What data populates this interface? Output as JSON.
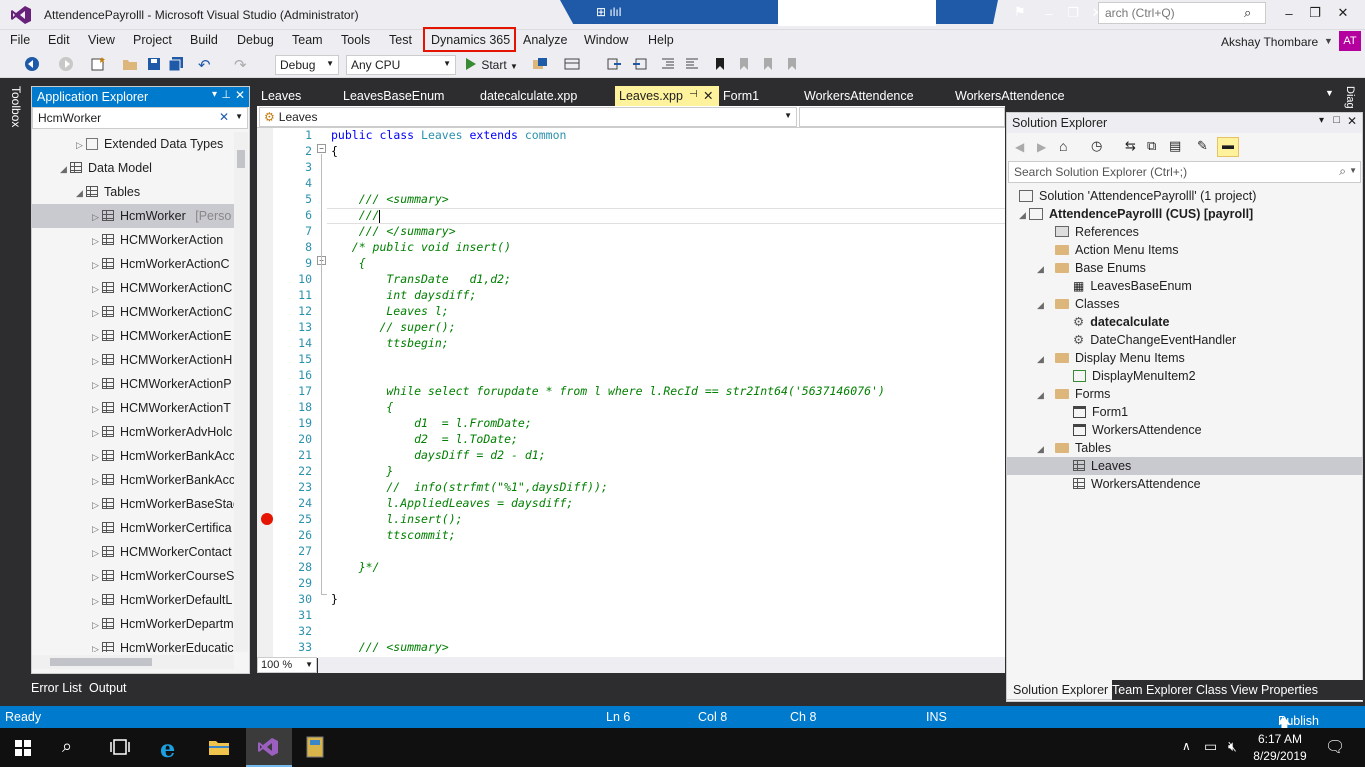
{
  "window": {
    "title": "AttendencePayrolll - Microsoft Visual Studio (Administrator)",
    "quick_launch": "arch (Ctrl+Q)"
  },
  "menu": [
    "File",
    "Edit",
    "View",
    "Project",
    "Build",
    "Debug",
    "Team",
    "Tools",
    "Test",
    "Dynamics 365",
    "Analyze",
    "Window",
    "Help"
  ],
  "user": {
    "name": "Akshay Thombare",
    "initials": "AT"
  },
  "toolbar": {
    "config": "Debug",
    "platform": "Any CPU",
    "start": "Start"
  },
  "toolbox_label": "Toolbox",
  "app_explorer": {
    "title": "Application Explorer",
    "search": "HcmWorker",
    "items": [
      "Extended Data Types",
      "Data Model",
      "Tables",
      "HcmWorker",
      "HCMWorkerAction",
      "HcmWorkerActionC",
      "HCMWorkerActionC",
      "HCMWorkerActionC",
      "HCMWorkerActionE",
      "HCMWorkerActionH",
      "HCMWorkerActionP",
      "HCMWorkerActionT",
      "HcmWorkerAdvHolc",
      "HcmWorkerBankAcc",
      "HcmWorkerBankAcc",
      "HcmWorkerBaseStag",
      "HcmWorkerCertifica",
      "HCMWorkerContact",
      "HcmWorkerCourseS",
      "HcmWorkerDefaultL",
      "HcmWorkerDepartm",
      "HcmWorkerEducatic"
    ],
    "selected_suffix": "[Perso"
  },
  "editor": {
    "tabs": [
      "Leaves",
      "LeavesBaseEnum",
      "datecalculate.xpp",
      "Leaves.xpp",
      "Form1",
      "WorkersAttendence",
      "WorkersAttendence"
    ],
    "active_tab": "Leaves.xpp",
    "nav": "Leaves",
    "zoom": "100 %",
    "lines": [
      {
        "n": "1",
        "t": "public class Leaves extends common",
        "k": "decl"
      },
      {
        "n": "2",
        "t": "{",
        "k": "plain"
      },
      {
        "n": "3",
        "t": "",
        "k": "plain"
      },
      {
        "n": "4",
        "t": "",
        "k": "plain"
      },
      {
        "n": "5",
        "t": "    /// <summary>",
        "k": "cm"
      },
      {
        "n": "6",
        "t": "    ///",
        "k": "cm"
      },
      {
        "n": "7",
        "t": "    /// </summary>",
        "k": "cm"
      },
      {
        "n": "8",
        "t": "   /* public void insert()",
        "k": "cm"
      },
      {
        "n": "9",
        "t": "    {",
        "k": "cm"
      },
      {
        "n": "10",
        "t": "        TransDate   d1,d2;",
        "k": "cm"
      },
      {
        "n": "11",
        "t": "        int daysdiff;",
        "k": "cm"
      },
      {
        "n": "12",
        "t": "        Leaves l;",
        "k": "cm"
      },
      {
        "n": "13",
        "t": "       // super();",
        "k": "cm"
      },
      {
        "n": "14",
        "t": "        ttsbegin;",
        "k": "cm"
      },
      {
        "n": "15",
        "t": "",
        "k": "cm"
      },
      {
        "n": "16",
        "t": "",
        "k": "cm"
      },
      {
        "n": "17",
        "t": "        while select forupdate * from l where l.RecId == str2Int64('5637146076')",
        "k": "cm"
      },
      {
        "n": "18",
        "t": "        {",
        "k": "cm"
      },
      {
        "n": "19",
        "t": "            d1  = l.FromDate;",
        "k": "cm"
      },
      {
        "n": "20",
        "t": "            d2  = l.ToDate;",
        "k": "cm"
      },
      {
        "n": "21",
        "t": "            daysDiff = d2 - d1;",
        "k": "cm"
      },
      {
        "n": "22",
        "t": "        }",
        "k": "cm"
      },
      {
        "n": "23",
        "t": "        //  info(strfmt(\"%1\",daysDiff));",
        "k": "cm"
      },
      {
        "n": "24",
        "t": "        l.AppliedLeaves = daysdiff;",
        "k": "cm"
      },
      {
        "n": "25",
        "t": "        l.insert();",
        "k": "cm"
      },
      {
        "n": "26",
        "t": "        ttscommit;",
        "k": "cm"
      },
      {
        "n": "27",
        "t": "",
        "k": "cm"
      },
      {
        "n": "28",
        "t": "    }*/",
        "k": "cm"
      },
      {
        "n": "29",
        "t": "",
        "k": "plain"
      },
      {
        "n": "30",
        "t": "}",
        "k": "plain"
      },
      {
        "n": "31",
        "t": "",
        "k": "plain"
      },
      {
        "n": "32",
        "t": "",
        "k": "plain"
      },
      {
        "n": "33",
        "t": "    /// <summary>",
        "k": "cm"
      }
    ],
    "breakpoint_line": "25"
  },
  "solution_explorer": {
    "title": "Solution Explorer",
    "search": "Search Solution Explorer (Ctrl+;)",
    "items": [
      {
        "t": "Solution 'AttendencePayrolll' (1 project)",
        "bold": false
      },
      {
        "t": "AttendencePayrolll (CUS) [payroll]",
        "bold": true
      },
      {
        "t": "References",
        "bold": false
      },
      {
        "t": "Action Menu Items",
        "bold": false
      },
      {
        "t": "Base Enums",
        "bold": false
      },
      {
        "t": "LeavesBaseEnum",
        "bold": false
      },
      {
        "t": "Classes",
        "bold": false
      },
      {
        "t": "datecalculate",
        "bold": true
      },
      {
        "t": "DateChangeEventHandler",
        "bold": false
      },
      {
        "t": "Display Menu Items",
        "bold": false
      },
      {
        "t": "DisplayMenuItem2",
        "bold": false
      },
      {
        "t": "Forms",
        "bold": false
      },
      {
        "t": "Form1",
        "bold": false
      },
      {
        "t": "WorkersAttendence",
        "bold": false
      },
      {
        "t": "Tables",
        "bold": false
      },
      {
        "t": "Leaves",
        "bold": false
      },
      {
        "t": "WorkersAttendence",
        "bold": false
      }
    ],
    "tabs": [
      "Solution Explorer",
      "Team Explorer",
      "Class View",
      "Properties"
    ]
  },
  "bottom_tabs": [
    "Error List",
    "Output"
  ],
  "diag_label": "Diag",
  "status": {
    "ready": "Ready",
    "ln": "Ln 6",
    "col": "Col 8",
    "ch": "Ch 8",
    "mode": "INS",
    "publish": "Publish"
  },
  "taskbar": {
    "time": "6:17 AM",
    "date": "8/29/2019"
  },
  "colors": {
    "accent": "#007acc",
    "highlight_tab": "#fff29d",
    "breakpoint": "#e51400"
  }
}
